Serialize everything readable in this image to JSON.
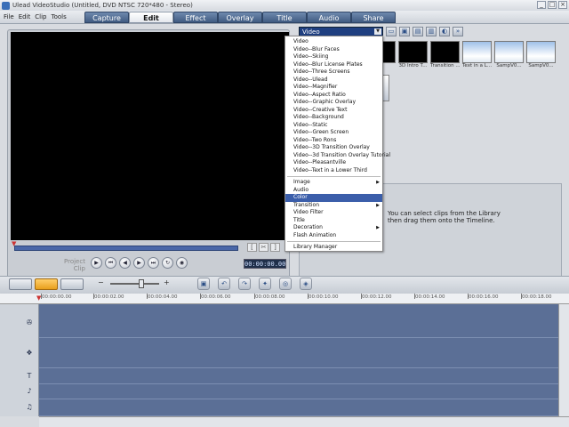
{
  "window": {
    "title": "Ulead VideoStudio (Untitled, DVD NTSC 720*480 - Stereo)",
    "controls": [
      "_",
      "□",
      "×"
    ]
  },
  "menu": [
    "File",
    "Edit",
    "Clip",
    "Tools"
  ],
  "steps": [
    "Capture",
    "Edit",
    "Effect",
    "Overlay",
    "Title",
    "Audio",
    "Share"
  ],
  "active_step": "Edit",
  "preview": {
    "mode_project": "Project",
    "mode_clip": "Clip",
    "timecode": "00:00:00.00"
  },
  "library": {
    "selected_category": "Video",
    "thumbnails": [
      {
        "caption": ""
      },
      {
        "caption": "3D Intro T..."
      },
      {
        "caption": "Transition ..."
      },
      {
        "caption": "Text in a L..."
      },
      {
        "caption": "SampV0..."
      },
      {
        "caption": "SampV0..."
      }
    ],
    "info_text": "You can select clips from the Library then drag them onto the Timeline."
  },
  "dropdown": {
    "group1": [
      "Video",
      "Video--Blur Faces",
      "Video--Skiing",
      "Video--Blur License Plates",
      "Video--Three Screens",
      "Video--Ulead",
      "Video--Magnifier",
      "Video--Aspect Ratio",
      "Video--Graphic Overlay",
      "Video--Creative Text",
      "Video--Background",
      "Video--Static",
      "Video--Green Screen",
      "Video--Two Rons",
      "Video--3D Transition Overlay",
      "Video--3d Transition Overlay Tutorial",
      "Video--Pleasantville",
      "Video--Text in a Lower Third"
    ],
    "group2": [
      {
        "label": "Image",
        "submenu": true
      },
      {
        "label": "Audio",
        "submenu": false
      },
      {
        "label": "Color",
        "submenu": false,
        "selected": true
      },
      {
        "label": "Transition",
        "submenu": true
      },
      {
        "label": "Video Filter",
        "submenu": false
      },
      {
        "label": "Title",
        "submenu": false
      },
      {
        "label": "Decoration",
        "submenu": true
      },
      {
        "label": "Flash Animation",
        "submenu": false
      }
    ],
    "group3": [
      "Library Manager"
    ]
  },
  "timeline": {
    "ruler": [
      "00:00:00.00",
      "00:00:02.00",
      "00:00:04.00",
      "00:00:06.00",
      "00:00:08.00",
      "00:00:10.00",
      "00:00:12.00",
      "00:00:14.00",
      "00:00:16.00",
      "00:00:18.00"
    ],
    "track_icons": [
      "film-reel-icon",
      "overlay-icon",
      "title-text-icon",
      "voice-icon",
      "music-icon"
    ]
  }
}
